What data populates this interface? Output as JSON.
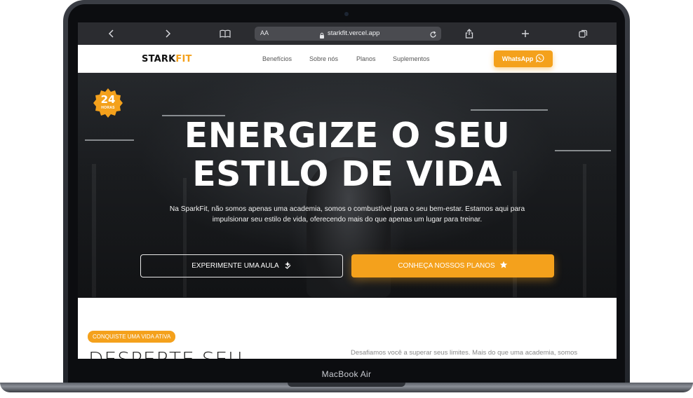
{
  "device": {
    "model_label": "MacBook Air"
  },
  "browser": {
    "text_size_label": "AA",
    "url": "starkfit.vercel.app",
    "icons": [
      "back-icon",
      "forward-icon",
      "bookmarks-icon",
      "lock-icon",
      "reload-icon",
      "share-icon",
      "new-tab-icon",
      "tabs-icon"
    ]
  },
  "nav": {
    "logo_primary": "STARK",
    "logo_accent": "FIT",
    "links": [
      "Benefícios",
      "Sobre nós",
      "Planos",
      "Suplementos"
    ],
    "whatsapp_label": "WhatsApp"
  },
  "hero": {
    "badge_number": "24",
    "badge_label": "HORAS",
    "title_line1": "ENERGIZE O SEU",
    "title_line2": "ESTILO DE VIDA",
    "description": "Na SparkFit, não somos apenas uma academia, somos o combustível para o seu bem-estar. Estamos aqui para impulsionar seu estilo de vida, oferecendo mais do que apenas um lugar para treinar.",
    "cta_secondary": "EXPERIMENTE UMA AULA",
    "cta_primary": "CONHEÇA NOSSOS PLANOS"
  },
  "section": {
    "tag": "CONQUISTE UMA VIDA ATIVA",
    "title": "DESPERTE SEU",
    "text": "Desafiamos você a superar seus limites. Mais do que uma academia, somos"
  },
  "colors": {
    "accent": "#f4a11c",
    "toolbar": "#2b2c30",
    "hero_dark": "#1b1d20"
  }
}
